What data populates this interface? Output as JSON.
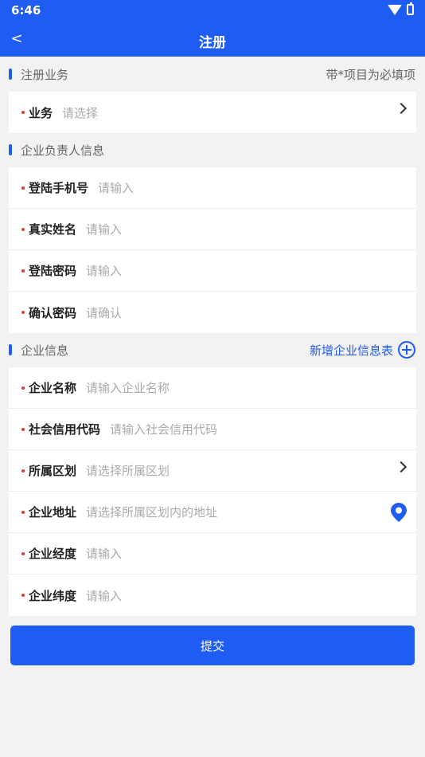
{
  "status_bar": {
    "time": "6:46"
  },
  "header": {
    "back": "<",
    "title": "注册"
  },
  "sections": {
    "business": {
      "title": "注册业务",
      "note": "带*项目为必填项"
    },
    "owner": {
      "title": "企业负责人信息"
    },
    "company": {
      "title": "企业信息",
      "add_link": "新增企业信息表"
    }
  },
  "business_fields": [
    {
      "label": "业务",
      "placeholder": "请选择"
    }
  ],
  "owner_fields": [
    {
      "label": "登陆手机号",
      "placeholder": "请输入"
    },
    {
      "label": "真实姓名",
      "placeholder": "请输入"
    },
    {
      "label": "登陆密码",
      "placeholder": "请输入"
    },
    {
      "label": "确认密码",
      "placeholder": "请确认"
    }
  ],
  "company_fields": [
    {
      "label": "企业名称",
      "placeholder": "请输入企业名称"
    },
    {
      "label": "社会信用代码",
      "placeholder": "请输入社会信用代码"
    },
    {
      "label": "所属区划",
      "placeholder": "请选择所属区划"
    },
    {
      "label": "企业地址",
      "placeholder": "请选择所属区划内的地址"
    },
    {
      "label": "企业经度",
      "placeholder": "请输入"
    },
    {
      "label": "企业纬度",
      "placeholder": "请输入"
    }
  ],
  "submit_label": "提交",
  "colors": {
    "accent": "#1f5cf2",
    "required": "#e53935"
  },
  "icons": [
    "wifi-icon",
    "battery-icon",
    "back-arrow-icon",
    "chevron-right-icon",
    "location-pin-icon",
    "plus-circle-icon"
  ]
}
